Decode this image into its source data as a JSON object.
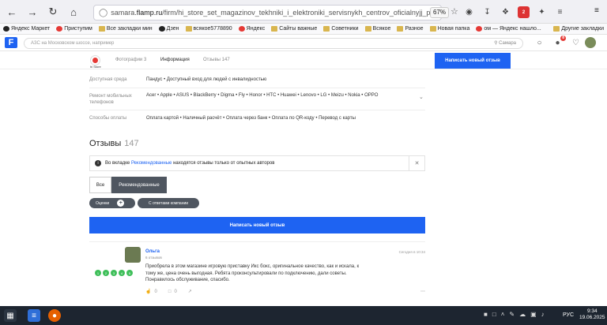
{
  "browser": {
    "url_prefix": "samara.",
    "url_domain": "flamp.ru",
    "url_path": "/firm/hi_store_set_magazinov_tekhniki_i_elektroniki_servisnykh_centrov_oficialnyjj_predstavite",
    "zoom": "67%",
    "ext_badge": "2",
    "bookmarks": [
      {
        "label": "Яндекс Маркет",
        "icon": "yandex-market-icon"
      },
      {
        "label": "Приступим",
        "icon": "folder-icon"
      },
      {
        "label": "Все закладки мин",
        "icon": "folder-icon"
      },
      {
        "label": "Дзен",
        "icon": "zen-icon"
      },
      {
        "label": "всякое5778890",
        "icon": "folder-icon"
      },
      {
        "label": "Яндекс",
        "icon": "yandex-icon"
      },
      {
        "label": "Сайты важные",
        "icon": "folder-icon"
      },
      {
        "label": "Советники",
        "icon": "folder-icon"
      },
      {
        "label": "Всякое",
        "icon": "folder-icon"
      },
      {
        "label": "Разное",
        "icon": "folder-icon"
      },
      {
        "label": "Новая папка",
        "icon": "folder-icon"
      },
      {
        "label": "ом — Яндекс нашло...",
        "icon": "yandex-icon"
      }
    ],
    "other_bookmarks": "Другие закладки"
  },
  "site_header": {
    "logo": "F",
    "search_placeholder": "АЗС на Московском шоссе, например",
    "city": "Самара",
    "notif_badge": "8"
  },
  "firm_tabs": {
    "store_short": "hi Store",
    "photos": "Фотографии 3",
    "info": "Информация",
    "reviews": "Отзывы 147",
    "write_button": "Написать новый отзыв"
  },
  "info_rows": [
    {
      "label": "Доступная среда",
      "value": "Пандус • Доступный вход для людей с инвалидностью"
    },
    {
      "label": "Ремонт мобильных телефонов",
      "value": "Acer • Apple • ASUS • BlackBerry • Digma • Fly • Honor • HTC • Huawei • Lenovo • LG • Meizu • Nokia • OPPO"
    },
    {
      "label": "Способы оплаты",
      "value": "Оплата картой • Наличный расчёт • Оплата через банк • Оплата по QR-коду • Перевод с карты"
    }
  ],
  "reviews": {
    "title": "Отзывы",
    "count": "147",
    "notice_prefix": "Во вкладке",
    "notice_link": "Рекомендованные",
    "notice_suffix": "находятся отзывы только от опытных авторов",
    "tab_all": "Все",
    "tab_recommended": "Рекомендованные",
    "chip_ratings": "Оценки",
    "chip_company": "С ответами компании",
    "write_button": "Написать новый отзыв"
  },
  "review_item": {
    "author": "Ольга",
    "meta": "6 отзывов",
    "date": "Сегодня в 10:34",
    "stars": [
      "1",
      "2",
      "3",
      "4",
      "5"
    ],
    "text": "Приобрела в этом магазине игровую приставку Икс бокс, оригинальное качество, как и искала, к тому же, цена очень выгодная. Ребята проконсультировали по подключению, дали советы. Понравилось обслуживание, спасибо.",
    "likes": "0",
    "comments": "0"
  },
  "taskbar": {
    "lang": "РУС",
    "time": "9:34",
    "date": "19.06.2025"
  }
}
